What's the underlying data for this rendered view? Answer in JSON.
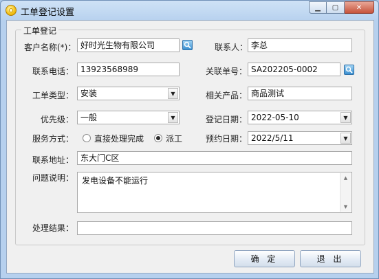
{
  "window": {
    "title": "工单登记设置"
  },
  "group": {
    "legend": "工单登记"
  },
  "form": {
    "customer_name": {
      "label": "客户名称(*)：",
      "value": "好时光生物有限公司"
    },
    "contact": {
      "label": "联系人：",
      "value": "李总"
    },
    "phone": {
      "label": "联系电话：",
      "value": "13923568989"
    },
    "related_order": {
      "label": "关联单号：",
      "value": "SA202205-0002"
    },
    "order_type": {
      "label": "工单类型：",
      "value": "安装"
    },
    "related_product": {
      "label": "相关产品：",
      "value": "商品测试"
    },
    "priority": {
      "label": "优先级：",
      "value": "一般"
    },
    "register_date": {
      "label": "登记日期：",
      "value": "2022-05-10"
    },
    "service_mode": {
      "label": "服务方式：",
      "options": [
        "直接处理完成",
        "派工"
      ],
      "selected": "派工"
    },
    "appointment_date": {
      "label": "预约日期：",
      "value": "2022/5/11"
    },
    "address": {
      "label": "联系地址：",
      "value": "东大门C区"
    },
    "problem": {
      "label": "问题说明：",
      "value": "发电设备不能运行"
    },
    "result": {
      "label": "处理结果：",
      "value": ""
    }
  },
  "buttons": {
    "ok": "确 定",
    "exit": "退 出"
  },
  "icons": {
    "app": "app-icon",
    "search": "search-icon",
    "minimize": "minimize-icon",
    "maximize": "maximize-icon",
    "close": "close-icon"
  }
}
